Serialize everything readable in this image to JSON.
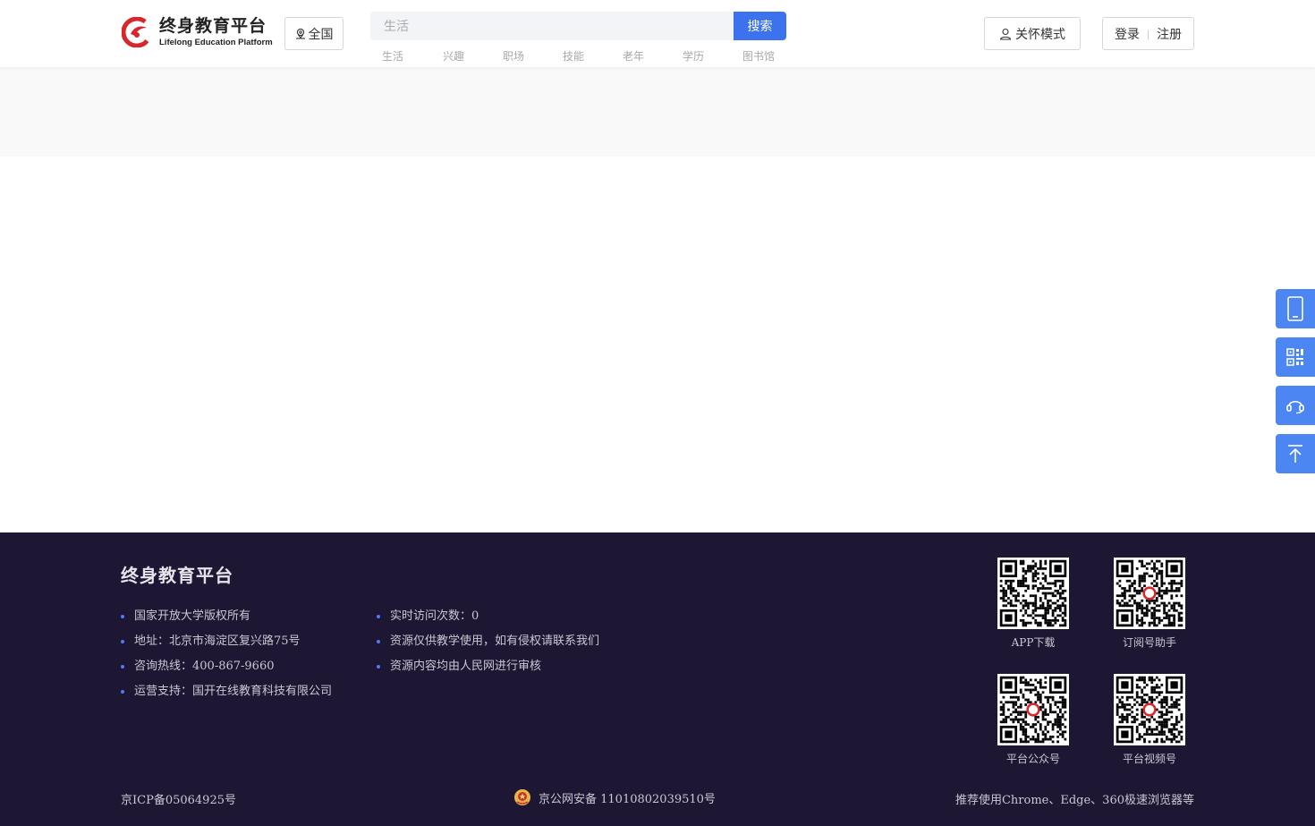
{
  "header": {
    "logo_cn": "终身教育平台",
    "logo_en": "Lifelong Education Platform",
    "region_label": "全国",
    "search_placeholder": "生活",
    "search_button": "搜索",
    "hot_tags": [
      "生活",
      "兴趣",
      "职场",
      "技能",
      "老年",
      "学历",
      "图书馆"
    ],
    "care_mode": "关怀模式",
    "login": "登录",
    "register": "注册"
  },
  "side_float": {
    "items": [
      "mobile-icon",
      "qrcode-icon",
      "headset-icon",
      "back-to-top-icon"
    ]
  },
  "footer": {
    "title": "终身教育平台",
    "col1": [
      "国家开放大学版权所有",
      "地址：北京市海淀区复兴路75号",
      "咨询热线：400-867-9660",
      "运营支持：国开在线教育科技有限公司"
    ],
    "col2": [
      "实时访问次数：0",
      "资源仅供教学使用，如有侵权请联系我们",
      "资源内容均由人民网进行审核"
    ],
    "qrcodes": [
      "APP下载",
      "订阅号助手",
      "平台公众号",
      "平台视频号"
    ],
    "icp": "京ICP备05064925号",
    "police": "京公网安备 11010802039510号",
    "browser_tip": "推荐使用Chrome、Edge、360极速浏览器等"
  },
  "colors": {
    "primary": "#3d72ef",
    "side_float": "#4b86f3",
    "footer_bg": "#1e1733",
    "logo_red": "#d7262c"
  }
}
